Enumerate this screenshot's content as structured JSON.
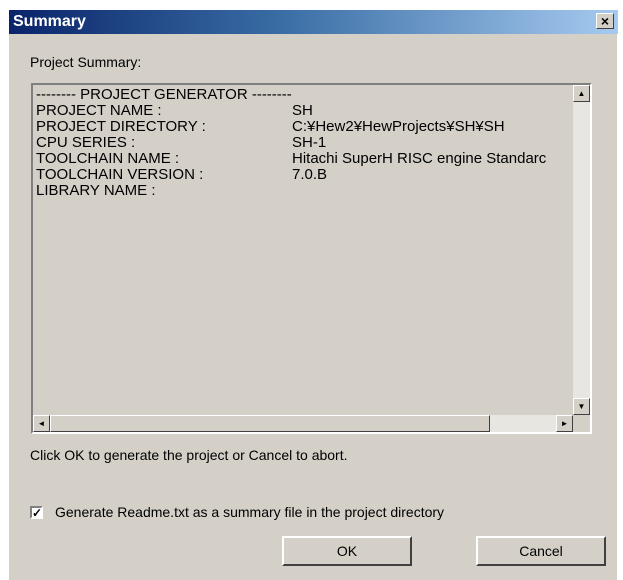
{
  "window": {
    "title": "Summary",
    "close_glyph": "×"
  },
  "summary_label": "Project Summary:",
  "summary": {
    "header_line": "-------- PROJECT GENERATOR --------",
    "rows": [
      {
        "key": "PROJECT NAME :",
        "value": "SH"
      },
      {
        "key": "PROJECT DIRECTORY :",
        "value": "C:¥Hew2¥HewProjects¥SH¥SH"
      },
      {
        "key": "CPU SERIES :",
        "value": "SH-1"
      },
      {
        "key": "TOOLCHAIN NAME :",
        "value": "Hitachi SuperH RISC engine Standarc"
      },
      {
        "key": "TOOLCHAIN VERSION :",
        "value": "7.0.B"
      },
      {
        "key": "LIBRARY NAME :",
        "value": ""
      }
    ]
  },
  "scroll": {
    "up": "▲",
    "down": "▼",
    "left": "◄",
    "right": "►"
  },
  "instruction": "Click OK to generate the project or Cancel to abort.",
  "readme_checkbox": {
    "checked": true,
    "mark": "✓",
    "label": "Generate Readme.txt as a summary file in the project directory"
  },
  "buttons": {
    "ok": "OK",
    "cancel": "Cancel"
  }
}
